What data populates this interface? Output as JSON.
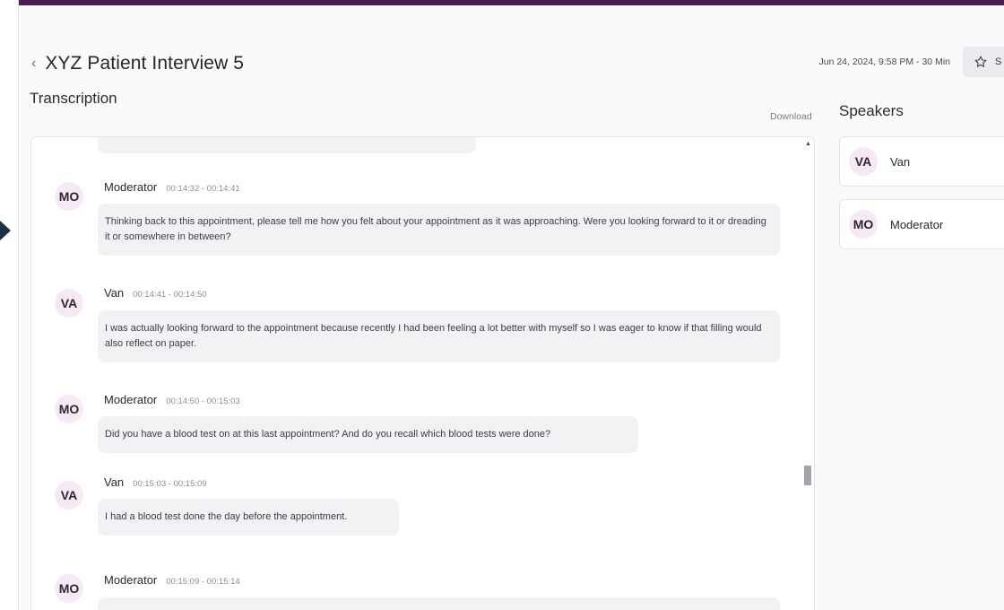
{
  "header": {
    "title": "XYZ Patient Interview 5",
    "back_icon": "chevron-left-icon",
    "meta": "Jun 24, 2024, 9:58 PM - 30 Min",
    "star_label": "S",
    "star_icon": "star-icon"
  },
  "transcription": {
    "title": "Transcription",
    "download_label": "Download",
    "messages": [
      {
        "initials": "MO",
        "speaker": "Moderator",
        "time": "00:14:32 - 00:14:41",
        "text": "Thinking back to this appointment, please tell me how you felt about your appointment as it was approaching. Were you looking forward to it or dreading it or somewhere in between?"
      },
      {
        "initials": "VA",
        "speaker": "Van",
        "time": "00:14:41 - 00:14:50",
        "text": "I was actually looking forward to the appointment because recently I had been feeling a lot better with myself so I was eager to know if that filling would also reflect on paper."
      },
      {
        "initials": "MO",
        "speaker": "Moderator",
        "time": "00:14:50 - 00:15:03",
        "text": "Did you have a blood test on at this last appointment? And do you recall which blood tests were done?"
      },
      {
        "initials": "VA",
        "speaker": "Van",
        "time": "00:15:03 - 00:15:09",
        "text": "I had a blood test done the day before the appointment."
      },
      {
        "initials": "MO",
        "speaker": "Moderator",
        "time": "00:15:09 - 00:15:14",
        "text": ""
      }
    ]
  },
  "speakers": {
    "title": "Speakers",
    "items": [
      {
        "initials": "VA",
        "name": "Van"
      },
      {
        "initials": "MO",
        "name": "Moderator"
      }
    ]
  },
  "colors": {
    "top_bar": "#4a1f4f",
    "avatar_bg": "#f7e8f6",
    "bubble_bg": "#f2f2f5",
    "side_pointer": "#1c2f44"
  }
}
